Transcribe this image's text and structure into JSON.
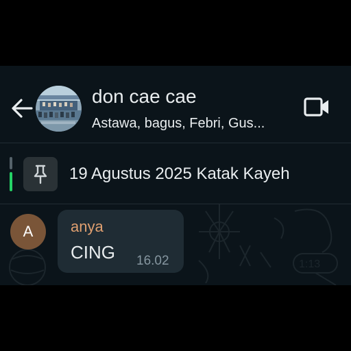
{
  "header": {
    "title": "don cae cae",
    "subtitle": "Astawa, bagus, Febri, Gus..."
  },
  "pinned": {
    "text": "19 Agustus 2025 Katak Kayeh"
  },
  "message": {
    "avatar_letter": "A",
    "sender": "anya",
    "text": "CING",
    "time": "16.02"
  },
  "colors": {
    "background": "#0b141a",
    "bubble": "#1f2c34",
    "sender_name": "#e0a070",
    "avatar": "#7a5538",
    "accent_green": "#25d366"
  },
  "icons": {
    "back": "arrow-left-icon",
    "video": "video-camera-icon",
    "pin": "pin-icon"
  }
}
